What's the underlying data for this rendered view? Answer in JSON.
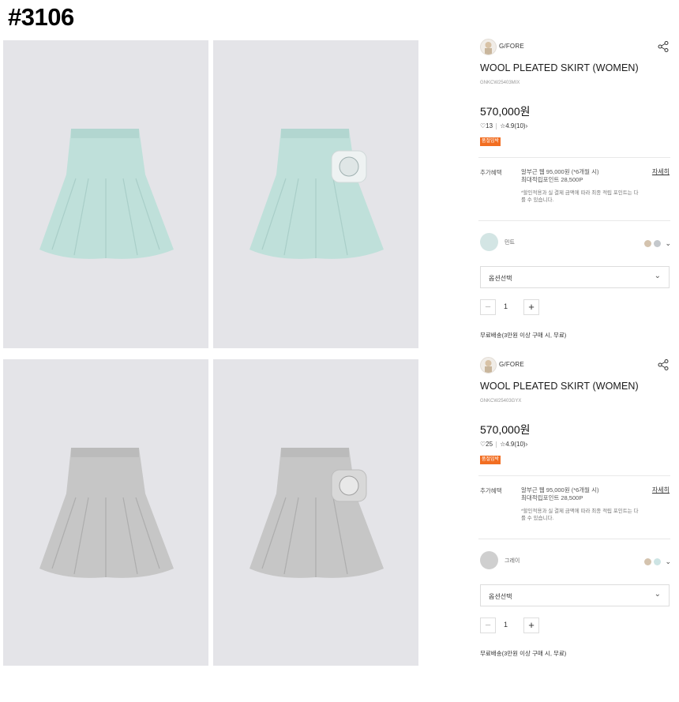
{
  "title": "#3106",
  "panels": [
    {
      "brand": "G/FORE",
      "name": "WOOL PLEATED SKIRT (WOMEN)",
      "code": "GNKCW25403MIX",
      "price": "570,000원",
      "likes": "13",
      "rating": "4.9(10)",
      "badge": "품절임박",
      "benefit_label": "추가혜택",
      "benefit_line1": "알부근 웹 95,000원 (*6개월 시)",
      "benefit_line2": "최대적립포인트 28,500P",
      "benefit_note": "*할인적용과 실 결제 금액에 따라 최종 적립 포인트는 다를 수 있습니다.",
      "detail": "자세히",
      "color_name": "민트",
      "color_hex": "#d3e5e4",
      "mini_colors": [
        "#d4c3ae",
        "#c4c8cc"
      ],
      "option": "옵션선택",
      "qty": "1",
      "shipping": "무료배송(3만원 이상 구매 시, 무료)"
    },
    {
      "brand": "G/FORE",
      "name": "WOOL PLEATED SKIRT (WOMEN)",
      "code": "GNKCW25403GYX",
      "price": "570,000원",
      "likes": "25",
      "rating": "4.9(10)",
      "badge": "품절임박",
      "benefit_label": "추가혜택",
      "benefit_line1": "알부근 웹 95,000원 (*6개월 시)",
      "benefit_line2": "최대적립포인트 28,500P",
      "benefit_note": "*할인적용과 실 결제 금액에 따라 최종 적립 포인트는 다를 수 있습니다.",
      "detail": "자세히",
      "color_name": "그레이",
      "color_hex": "#cfcfcf",
      "mini_colors": [
        "#d4c3ae",
        "#cde4e4"
      ],
      "option": "옵션선택",
      "qty": "1",
      "shipping": "무료배송(3만원 이상 구매 시, 무료)"
    }
  ],
  "images": [
    {
      "alt": "mint skirt front",
      "color": "#bfe0da",
      "shade": "#a9cec8",
      "pouch": false
    },
    {
      "alt": "mint skirt side with pouch",
      "color": "#bfe0da",
      "shade": "#a9cec8",
      "pouch": true
    },
    {
      "alt": "gray skirt front",
      "color": "#c6c6c6",
      "shade": "#adadad",
      "pouch": false
    },
    {
      "alt": "gray skirt side with pouch",
      "color": "#c6c6c6",
      "shade": "#adadad",
      "pouch": true
    }
  ]
}
